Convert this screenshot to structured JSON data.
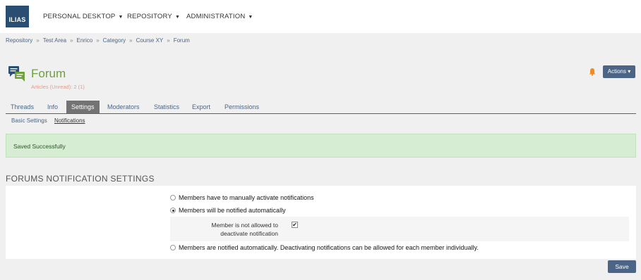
{
  "header": {
    "logo_text": "ILIAS",
    "nav": [
      {
        "label": "PERSONAL DESKTOP"
      },
      {
        "label": "REPOSITORY"
      },
      {
        "label": "ADMINISTRATION"
      }
    ]
  },
  "breadcrumb": [
    "Repository",
    "Test Area",
    "Enrico",
    "Category",
    "Course XY",
    "Forum"
  ],
  "breadcrumb_separator": "»",
  "page": {
    "title": "Forum",
    "subtitle": "Articles (Unread): 2 (1)",
    "actions_label": "Actions ▾"
  },
  "tabs": [
    "Threads",
    "Info",
    "Settings",
    "Moderators",
    "Statistics",
    "Export",
    "Permissions"
  ],
  "active_tab": "Settings",
  "subtabs": [
    "Basic Settings",
    "Notifications"
  ],
  "active_subtab": "Notifications",
  "alert": {
    "message": "Saved Successfully"
  },
  "settings": {
    "section_title": "FORUMS NOTIFICATION SETTINGS",
    "options": [
      {
        "label": "Members have to manually activate notifications",
        "checked": false
      },
      {
        "label": "Members will be notified automatically",
        "checked": true
      },
      {
        "label": "Members are notified automatically. Deactivating notifications can be allowed for each member individually.",
        "checked": false
      }
    ],
    "suboption": {
      "label_line1": "Member is not allowed to",
      "label_line2": "deactivate notification",
      "checked": true,
      "check_glyph": "✔"
    },
    "save_label": "Save"
  },
  "colors": {
    "accent": "#4c6586",
    "title": "#6ea03c",
    "logo_bg": "#294e72",
    "success_bg": "#d6ecd3",
    "bell": "#f08a24"
  },
  "icons": {
    "forum": "forum-icon",
    "bell": "bell-icon",
    "caret": "caret-down-icon"
  }
}
